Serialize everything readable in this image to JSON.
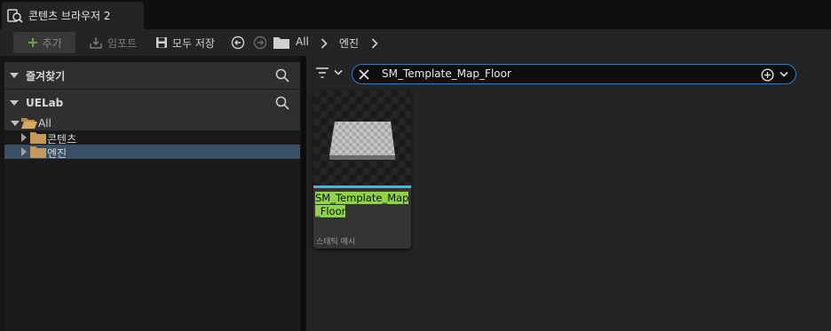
{
  "tab": {
    "label": "콘텐츠 브라우저 2",
    "icon": "content-browser-icon"
  },
  "toolbar": {
    "add_label": "추가",
    "import_label": "임포트",
    "save_all_label": "모두 저장",
    "breadcrumbs": [
      "All",
      "엔진"
    ]
  },
  "left_panel": {
    "favorites_label": "즐겨찾기",
    "project_label": "UELab",
    "tree": [
      {
        "label": "All",
        "expanded": true,
        "selected": false
      },
      {
        "label": "콘텐츠",
        "expanded": false,
        "selected": false
      },
      {
        "label": "엔진",
        "expanded": false,
        "selected": true
      }
    ]
  },
  "search": {
    "query": "SM_Template_Map_Floor"
  },
  "assets": [
    {
      "name_line1": "SM_Template_Map",
      "name_line2": "_Floor",
      "type": "스태틱 메시",
      "type_color": "#25c7d8"
    }
  ],
  "colors": {
    "accent": "#2a7fc8",
    "selection": "#3a4e66",
    "highlight": "#8fd34c",
    "static_mesh": "#25c7d8"
  }
}
